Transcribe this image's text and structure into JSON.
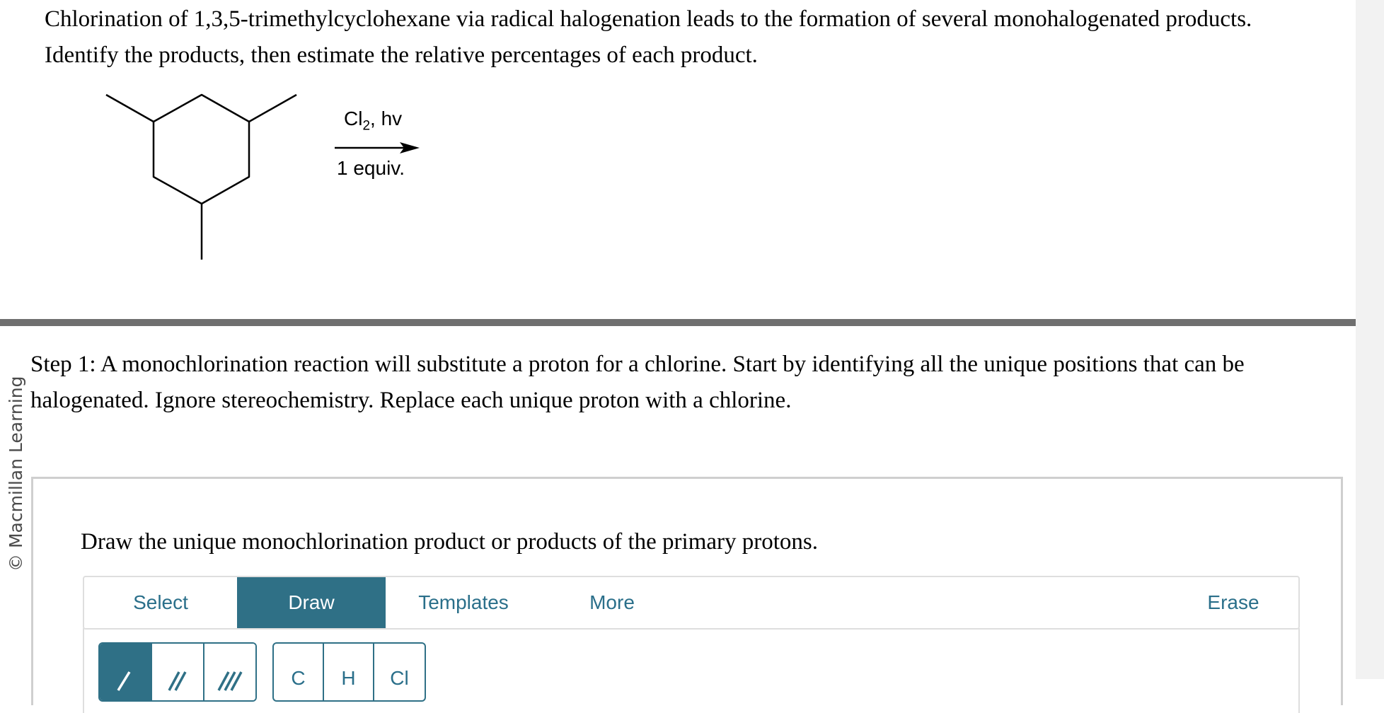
{
  "question": {
    "text": "Chlorination of 1,3,5-trimethylcyclohexane via radical halogenation leads to the formation of several monohalogenated products. Identify the products, then estimate the relative percentages of each product."
  },
  "reaction": {
    "reagent_main": "Cl",
    "reagent_subscript": "2",
    "reagent_suffix": ", hv",
    "condition": "1 equiv."
  },
  "copyright": "© Macmillan Learning",
  "step": {
    "text": "Step 1: A monochlorination reaction will substitute a proton for a chlorine. Start by identifying all the unique positions that can be halogenated. Ignore stereochemistry. Replace each unique proton with a chlorine."
  },
  "panel": {
    "prompt": "Draw the unique monochlorination product or products of the primary protons."
  },
  "toolbar": {
    "tabs": [
      "Select",
      "Draw",
      "Templates",
      "More"
    ],
    "active_tab": "Draw",
    "erase": "Erase"
  },
  "bond_tools": [
    "single-bond",
    "double-bond",
    "triple-bond"
  ],
  "atom_tools": [
    "C",
    "H",
    "Cl"
  ],
  "colors": {
    "accent": "#2f7086",
    "divider": "#6f6f6f"
  }
}
